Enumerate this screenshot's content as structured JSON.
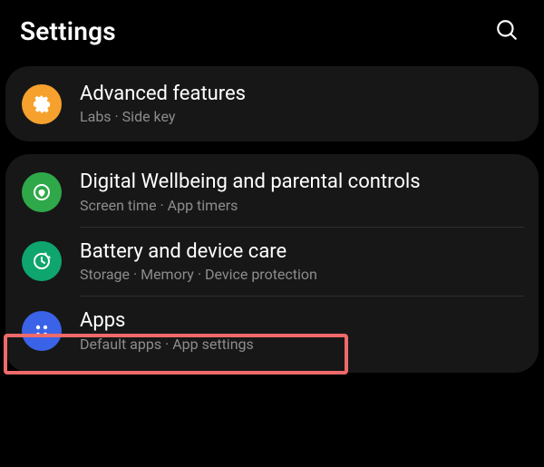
{
  "header": {
    "title": "Settings"
  },
  "groups": [
    {
      "items": [
        {
          "icon": "advanced",
          "title": "Advanced features",
          "sub": "Labs  ·  Side key"
        }
      ]
    },
    {
      "items": [
        {
          "icon": "wellbeing",
          "title": "Digital Wellbeing and parental controls",
          "sub": "Screen time  ·  App timers"
        },
        {
          "icon": "battery",
          "title": "Battery and device care",
          "sub": "Storage  ·  Memory  ·  Device protection"
        },
        {
          "icon": "apps",
          "title": "Apps",
          "sub": "Default apps  ·  App settings",
          "highlighted": true
        }
      ]
    }
  ],
  "colors": {
    "highlight": "#ef6a6a",
    "card": "#171717",
    "subtext": "#8c8c8c",
    "icons": {
      "advanced": "#f6a12e",
      "wellbeing": "#2fa84a",
      "battery": "#0fa56f",
      "apps": "#3a63e8"
    }
  }
}
